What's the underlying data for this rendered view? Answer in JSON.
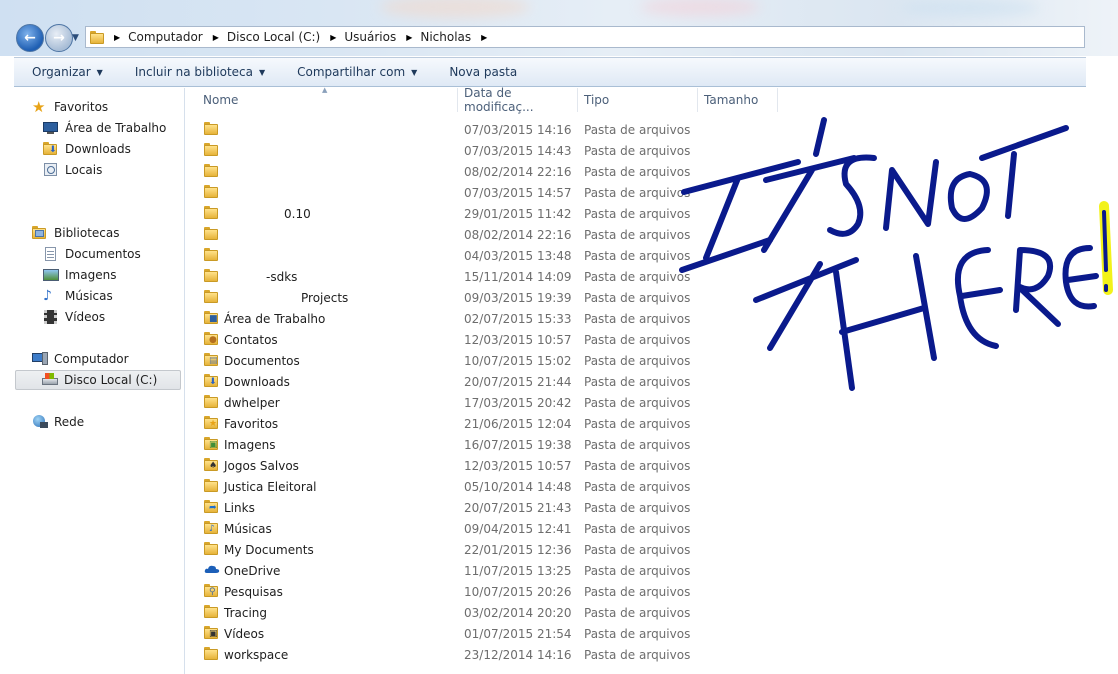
{
  "address": {
    "crumbs": [
      "Computador",
      "Disco Local (C:)",
      "Usuários",
      "Nicholas"
    ]
  },
  "toolbar": {
    "organize": "Organizar",
    "include_library": "Incluir na biblioteca",
    "share_with": "Compartilhar com",
    "new_folder": "Nova pasta"
  },
  "nav": {
    "favorites": "Favoritos",
    "desktop": "Área de Trabalho",
    "downloads": "Downloads",
    "places": "Locais",
    "libraries": "Bibliotecas",
    "documents": "Documentos",
    "images": "Imagens",
    "music": "Músicas",
    "videos": "Vídeos",
    "computer": "Computador",
    "local_disk": "Disco Local (C:)",
    "network": "Rede"
  },
  "columns": {
    "name": "Nome",
    "date": "Data de modificaç...",
    "type": "Tipo",
    "size": "Tamanho"
  },
  "files": [
    {
      "name": "",
      "date": "07/03/2015 14:16",
      "type": "Pasta de arquivos",
      "icon": "folder-icon"
    },
    {
      "name": "",
      "date": "07/03/2015 14:43",
      "type": "Pasta de arquivos",
      "icon": "folder-icon"
    },
    {
      "name": "",
      "date": "08/02/2014 22:16",
      "type": "Pasta de arquivos",
      "icon": "folder-icon"
    },
    {
      "name": "",
      "date": "07/03/2015 14:57",
      "type": "Pasta de arquivos",
      "icon": "folder-icon"
    },
    {
      "name": "0.10",
      "date": "29/01/2015 11:42",
      "type": "Pasta de arquivos",
      "icon": "folder-icon"
    },
    {
      "name": "",
      "date": "08/02/2014 22:16",
      "type": "Pasta de arquivos",
      "icon": "folder-icon"
    },
    {
      "name": "",
      "date": "04/03/2015 13:48",
      "type": "Pasta de arquivos",
      "icon": "folder-icon"
    },
    {
      "name": "-sdks",
      "date": "15/11/2014 14:09",
      "type": "Pasta de arquivos",
      "icon": "folder-icon"
    },
    {
      "name": "Projects",
      "date": "09/03/2015 19:39",
      "type": "Pasta de arquivos",
      "icon": "folder-icon"
    },
    {
      "name": "Área de Trabalho",
      "date": "02/07/2015 15:33",
      "type": "Pasta de arquivos",
      "icon": "desktop-folder-icon"
    },
    {
      "name": "Contatos",
      "date": "12/03/2015 10:57",
      "type": "Pasta de arquivos",
      "icon": "contacts-folder-icon"
    },
    {
      "name": "Documentos",
      "date": "10/07/2015 15:02",
      "type": "Pasta de arquivos",
      "icon": "documents-folder-icon"
    },
    {
      "name": "Downloads",
      "date": "20/07/2015 21:44",
      "type": "Pasta de arquivos",
      "icon": "downloads-folder-icon"
    },
    {
      "name": "dwhelper",
      "date": "17/03/2015 20:42",
      "type": "Pasta de arquivos",
      "icon": "folder-icon"
    },
    {
      "name": "Favoritos",
      "date": "21/06/2015 12:04",
      "type": "Pasta de arquivos",
      "icon": "favorites-folder-icon"
    },
    {
      "name": "Imagens",
      "date": "16/07/2015 19:38",
      "type": "Pasta de arquivos",
      "icon": "images-folder-icon"
    },
    {
      "name": "Jogos Salvos",
      "date": "12/03/2015 10:57",
      "type": "Pasta de arquivos",
      "icon": "saved-games-folder-icon"
    },
    {
      "name": "Justica Eleitoral",
      "date": "05/10/2014 14:48",
      "type": "Pasta de arquivos",
      "icon": "folder-icon"
    },
    {
      "name": "Links",
      "date": "20/07/2015 21:43",
      "type": "Pasta de arquivos",
      "icon": "links-folder-icon"
    },
    {
      "name": "Músicas",
      "date": "09/04/2015 12:41",
      "type": "Pasta de arquivos",
      "icon": "music-folder-icon"
    },
    {
      "name": "My Documents",
      "date": "22/01/2015 12:36",
      "type": "Pasta de arquivos",
      "icon": "folder-icon"
    },
    {
      "name": "OneDrive",
      "date": "11/07/2015 13:25",
      "type": "Pasta de arquivos",
      "icon": "onedrive-icon"
    },
    {
      "name": "Pesquisas",
      "date": "10/07/2015 20:26",
      "type": "Pasta de arquivos",
      "icon": "searches-folder-icon"
    },
    {
      "name": "Tracing",
      "date": "03/02/2014 20:20",
      "type": "Pasta de arquivos",
      "icon": "folder-icon"
    },
    {
      "name": "Vídeos",
      "date": "01/07/2015 21:54",
      "type": "Pasta de arquivos",
      "icon": "videos-folder-icon"
    },
    {
      "name": "workspace",
      "date": "23/12/2014 14:16",
      "type": "Pasta de arquivos",
      "icon": "folder-icon"
    }
  ],
  "annotation": {
    "text": "IT'S NOT THERE!",
    "ink_color": "#0a1a8c",
    "highlight_color": "#f2f21a"
  },
  "colors": {
    "selection": "#e3e6ea",
    "header_text": "#4c607a"
  }
}
